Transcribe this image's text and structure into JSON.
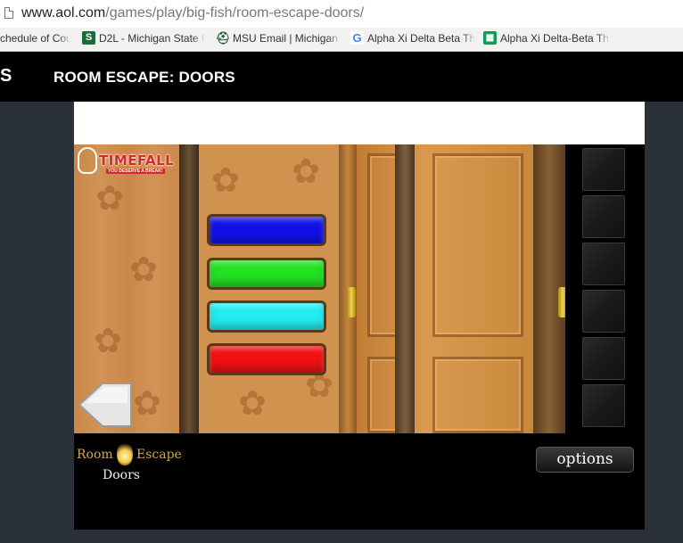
{
  "browser": {
    "url_host": "www.aol.com",
    "url_path": "/games/play/big-fish/room-escape-doors/"
  },
  "bookmarks": [
    {
      "label": "chedule of Cou",
      "icon": "page-icon"
    },
    {
      "label": "D2L - Michigan State U",
      "icon": "msu-s-icon"
    },
    {
      "label": "MSU Email | Michigan S",
      "icon": "spartan-helmet-icon"
    },
    {
      "label": "Alpha Xi Delta Beta Th",
      "icon": "google-g-icon"
    },
    {
      "label": "Alpha Xi Delta-Beta Th",
      "icon": "sheets-icon"
    }
  ],
  "site": {
    "logo_fragment": "S",
    "game_title": "ROOM ESCAPE: DOORS"
  },
  "game": {
    "brand": "TIMEFALL",
    "brand_tagline": "YOU DESERVE A BREAK!",
    "color_buttons": [
      {
        "name": "blue",
        "color": "#1010e8"
      },
      {
        "name": "green",
        "color": "#22e022"
      },
      {
        "name": "cyan",
        "color": "#22ecf0"
      },
      {
        "name": "red",
        "color": "#f01010"
      }
    ],
    "inventory_slot_count": 6,
    "logo_room": "Room",
    "logo_escape": "Escape",
    "logo_doors": "Doors",
    "options_label": "options"
  },
  "colors": {
    "header_bg": "#000000",
    "page_bg": "#2a3138",
    "accent_logo": "#d6a64a"
  }
}
